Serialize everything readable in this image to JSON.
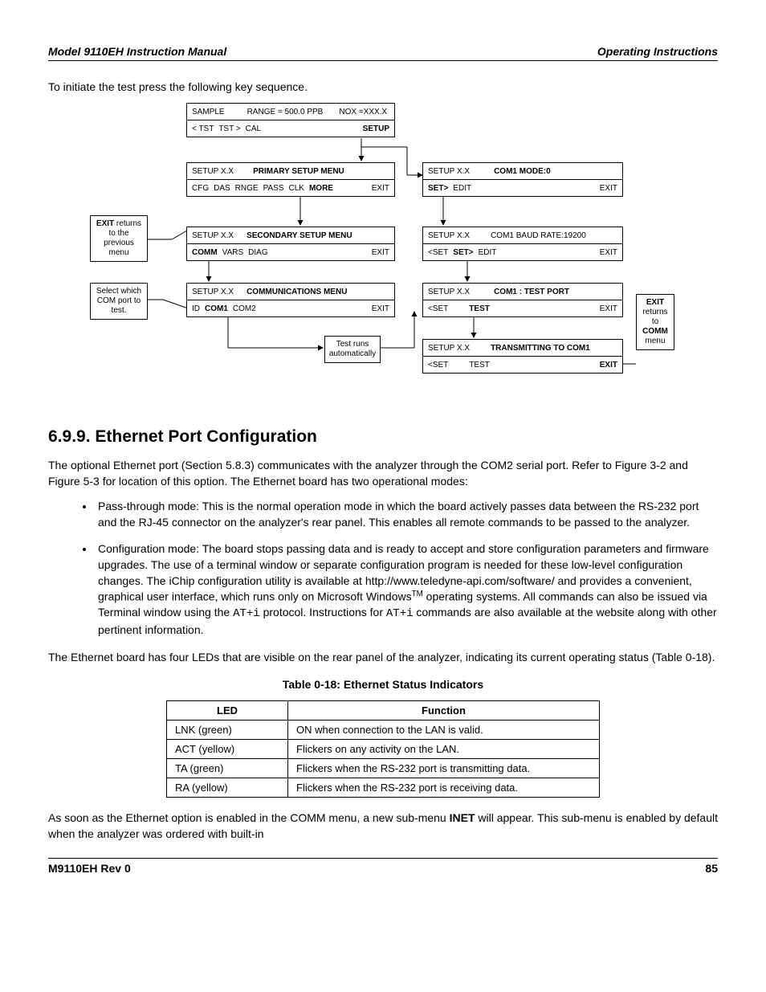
{
  "header": {
    "left": "Model 9110EH Instruction Manual",
    "right": "Operating Instructions"
  },
  "intro": "To initiate the test press the following key sequence.",
  "diagram": {
    "box1": {
      "r1": {
        "a": "SAMPLE",
        "b": "RANGE = 500.0 PPB",
        "c": "NOX =XXX.X"
      },
      "r2": {
        "a": "< TST",
        "b": "TST >",
        "c": "CAL",
        "d": "SETUP"
      }
    },
    "box2": {
      "r1": {
        "a": "SETUP X.X",
        "b": "PRIMARY SETUP MENU"
      },
      "r2": {
        "a": "CFG",
        "b": "DAS",
        "c": "RNGE",
        "d": "PASS",
        "e": "CLK",
        "f": "MORE",
        "g": "EXIT"
      }
    },
    "box3": {
      "r1": {
        "a": "SETUP X.X",
        "b": "SECONDARY SETUP MENU"
      },
      "r2": {
        "a": "COMM",
        "b": "VARS",
        "c": "DIAG",
        "d": "EXIT"
      }
    },
    "box4": {
      "r1": {
        "a": "SETUP X.X",
        "b": "COMMUNICATIONS MENU"
      },
      "r2": {
        "a": "ID",
        "b": "COM1",
        "c": "COM2",
        "d": "EXIT"
      }
    },
    "box5": {
      "r1": {
        "a": "SETUP X.X",
        "b": "COM1 MODE:0"
      },
      "r2": {
        "a": "SET>",
        "b": "EDIT",
        "c": "EXIT"
      }
    },
    "box6": {
      "r1": {
        "a": "SETUP X.X",
        "b": "COM1 BAUD RATE:19200"
      },
      "r2": {
        "a": "<SET",
        "b": "SET>",
        "c": "EDIT",
        "d": "EXIT"
      }
    },
    "box7": {
      "r1": {
        "a": "SETUP X.X",
        "b": "COM1 : TEST PORT"
      },
      "r2": {
        "a": "<SET",
        "b": "TEST",
        "c": "EXIT"
      }
    },
    "box8": {
      "r1": {
        "a": "SETUP X.X",
        "b": "TRANSMITTING TO COM1"
      },
      "r2": {
        "a": "<SET",
        "b": "TEST",
        "c": "EXIT"
      }
    },
    "note_exit_left": "EXIT returns to the previous menu",
    "note_select": "Select which COM port to test.",
    "note_test_runs": "Test runs automatically",
    "note_exit_right": "EXIT returns to COMM menu",
    "note_exit_right_parts": {
      "a": "EXIT",
      "b": "returns",
      "c": "to",
      "d": "COMM",
      "e": "menu"
    }
  },
  "section_heading": "6.9.9. Ethernet Port Configuration",
  "para1": "The optional Ethernet port (Section 5.8.3) communicates with the analyzer through the COM2 serial port. Refer to Figure 3-2 and Figure 5-3 for location of this option. The Ethernet board has two operational modes:",
  "bullets": {
    "b1": "Pass-through mode: This is the normal operation mode in which the board actively passes data between the RS-232 port and the RJ-45 connector on the analyzer's rear panel. This enables all remote commands to be passed to the analyzer.",
    "b2a": "Configuration mode: The board stops passing data and is ready to accept and store configuration parameters and firmware upgrades. The use of a terminal window or separate configuration program is needed for these low-level configuration changes. The iChip configuration utility is available at http://www.teledyne-api.com/software/ and provides a convenient, graphical user interface, which runs only on Microsoft Windows",
    "b2b": " operating systems. All commands can also be issued via Terminal window using the ",
    "b2c": " protocol. Instructions for ",
    "b2d": " commands are also available at the website along with other pertinent information.",
    "at_i": "AT+i",
    "tm": "TM"
  },
  "para2": "The Ethernet board has four LEDs that are visible on the rear panel of the analyzer, indicating its current operating status (Table 0-18).",
  "table_caption": "Table 0-18:  Ethernet Status Indicators",
  "table": {
    "h1": "LED",
    "h2": "Function",
    "r1": {
      "led": "LNK (green)",
      "fn": "ON when connection to the LAN is valid."
    },
    "r2": {
      "led": "ACT (yellow)",
      "fn": "Flickers on any activity on the LAN."
    },
    "r3": {
      "led": "TA (green)",
      "fn": "Flickers when the RS-232 port is transmitting data."
    },
    "r4": {
      "led": "RA (yellow)",
      "fn": "Flickers when the RS-232 port is receiving data."
    }
  },
  "para3a": "As soon as the Ethernet option is enabled in the COMM menu, a new sub-menu ",
  "para3b": "INET",
  "para3c": " will appear. This sub-menu is enabled by default when the analyzer was ordered with built-in",
  "footer": {
    "left": "M9110EH Rev 0",
    "right": "85"
  }
}
